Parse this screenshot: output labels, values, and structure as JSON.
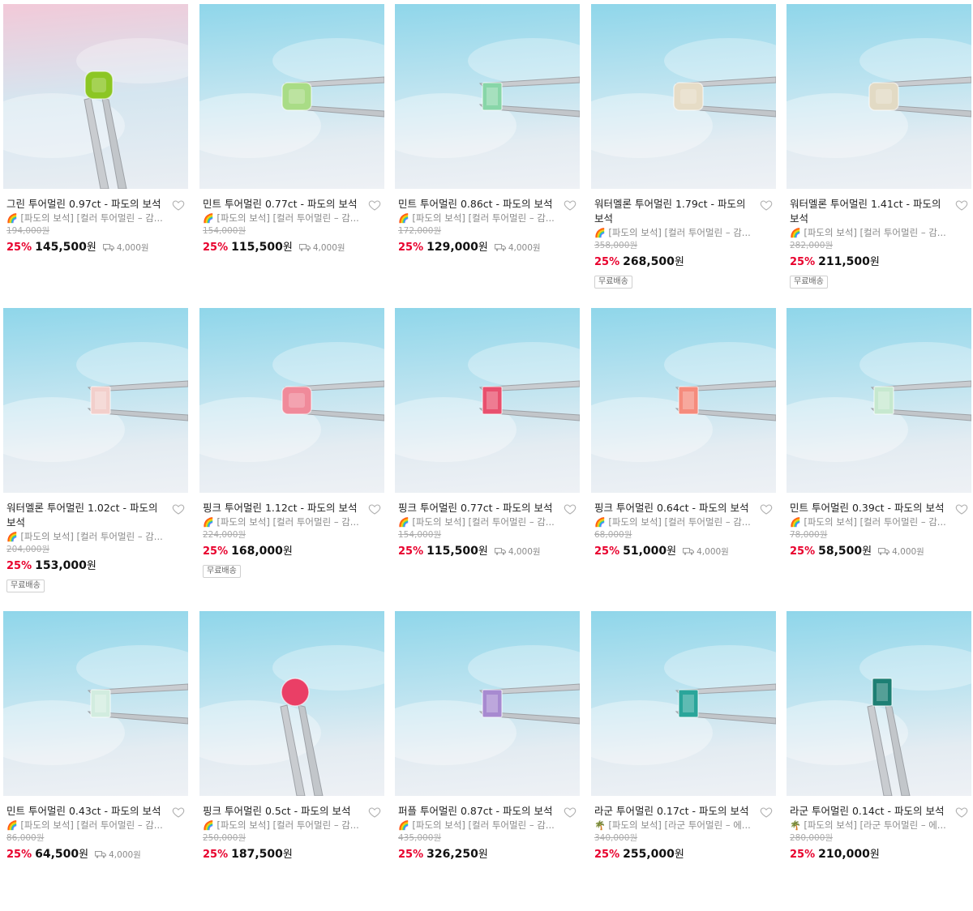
{
  "colors": {
    "discount": "#e8002d",
    "price": "#111111",
    "muted": "#8a8a8a"
  },
  "products": [
    {
      "title": "그린 투어멀린 0.97ct - 파도의 보석",
      "shop_icon": "🌈",
      "shop": "[파도의 보석] [컬러 투어멀린 – 감...",
      "original_price": "194,000원",
      "discount": "25%",
      "price": "145,500",
      "currency": "원",
      "shipping": "4,000원",
      "badge": "",
      "gem_color": "#8cc624",
      "gem_shape": "cushion",
      "bg": "pink",
      "tweezer": "diag"
    },
    {
      "title": "민트 투어멀린 0.77ct - 파도의 보석",
      "shop_icon": "🌈",
      "shop": "[파도의 보석] [컬러 투어멀린 – 감...",
      "original_price": "154,000원",
      "discount": "25%",
      "price": "115,500",
      "currency": "원",
      "shipping": "4,000원",
      "badge": "",
      "gem_color": "#a9dc86",
      "gem_shape": "square",
      "bg": "sky",
      "tweezer": "horiz"
    },
    {
      "title": "민트 투어멀린 0.86ct - 파도의 보석",
      "shop_icon": "🌈",
      "shop": "[파도의 보석] [컬러 투어멀린 – 감...",
      "original_price": "172,000원",
      "discount": "25%",
      "price": "129,000",
      "currency": "원",
      "shipping": "4,000원",
      "badge": "",
      "gem_color": "#88d6a8",
      "gem_shape": "emerald",
      "bg": "sky",
      "tweezer": "horiz"
    },
    {
      "title": "워터멜론 투어멀린 1.79ct - 파도의 보석",
      "shop_icon": "🌈",
      "shop": "[파도의 보석] [컬러 투어멀린 – 감...",
      "original_price": "358,000원",
      "discount": "25%",
      "price": "268,500",
      "currency": "원",
      "shipping": "",
      "badge": "무료배송",
      "gem_color": "#e6dcc6",
      "gem_shape": "square",
      "bg": "sky",
      "tweezer": "horiz"
    },
    {
      "title": "워터멜론 투어멀린 1.41ct - 파도의 보석",
      "shop_icon": "🌈",
      "shop": "[파도의 보석] [컬러 투어멀린 – 감...",
      "original_price": "282,000원",
      "discount": "25%",
      "price": "211,500",
      "currency": "원",
      "shipping": "",
      "badge": "무료배송",
      "gem_color": "#e2dac4",
      "gem_shape": "square",
      "bg": "sky",
      "tweezer": "horiz"
    },
    {
      "title": "워터멜론 투어멀린 1.02ct - 파도의 보석",
      "shop_icon": "🌈",
      "shop": "[파도의 보석] [컬러 투어멀린 – 감...",
      "original_price": "204,000원",
      "discount": "25%",
      "price": "153,000",
      "currency": "원",
      "shipping": "",
      "badge": "무료배송",
      "gem_color": "#f2cfcb",
      "gem_shape": "emerald",
      "bg": "sky",
      "tweezer": "horiz"
    },
    {
      "title": "핑크 투어멀린 1.12ct - 파도의 보석",
      "shop_icon": "🌈",
      "shop": "[파도의 보석] [컬러 투어멀린 – 감...",
      "original_price": "224,000원",
      "discount": "25%",
      "price": "168,000",
      "currency": "원",
      "shipping": "",
      "badge": "무료배송",
      "gem_color": "#f08a9a",
      "gem_shape": "square",
      "bg": "sky",
      "tweezer": "horiz"
    },
    {
      "title": "핑크 투어멀린 0.77ct - 파도의 보석",
      "shop_icon": "🌈",
      "shop": "[파도의 보석] [컬러 투어멀린 – 감...",
      "original_price": "154,000원",
      "discount": "25%",
      "price": "115,500",
      "currency": "원",
      "shipping": "4,000원",
      "badge": "",
      "gem_color": "#e8506e",
      "gem_shape": "emerald",
      "bg": "sky",
      "tweezer": "horiz"
    },
    {
      "title": "핑크 투어멀린 0.64ct - 파도의 보석",
      "shop_icon": "🌈",
      "shop": "[파도의 보석] [컬러 투어멀린 – 감...",
      "original_price": "68,000원",
      "discount": "25%",
      "price": "51,000",
      "currency": "원",
      "shipping": "4,000원",
      "badge": "",
      "gem_color": "#f58b7c",
      "gem_shape": "emerald",
      "bg": "sky",
      "tweezer": "horiz"
    },
    {
      "title": "민트 투어멀린 0.39ct - 파도의 보석",
      "shop_icon": "🌈",
      "shop": "[파도의 보석] [컬러 투어멀린 – 감...",
      "original_price": "78,000원",
      "discount": "25%",
      "price": "58,500",
      "currency": "원",
      "shipping": "4,000원",
      "badge": "",
      "gem_color": "#c6e8cf",
      "gem_shape": "emerald",
      "bg": "sky",
      "tweezer": "horiz"
    },
    {
      "title": "민트 투어멀린 0.43ct - 파도의 보석",
      "shop_icon": "🌈",
      "shop": "[파도의 보석] [컬러 투어멀린 – 감...",
      "original_price": "86,000원",
      "discount": "25%",
      "price": "64,500",
      "currency": "원",
      "shipping": "4,000원",
      "badge": "",
      "gem_color": "#d2ecdf",
      "gem_shape": "emerald",
      "bg": "sky",
      "tweezer": "horiz"
    },
    {
      "title": "핑크 투어멀린 0.5ct - 파도의 보석",
      "shop_icon": "🌈",
      "shop": "[파도의 보석] [컬러 투어멀린 – 감...",
      "original_price": "250,000원",
      "discount": "25%",
      "price": "187,500",
      "currency": "원",
      "shipping": "",
      "badge": "",
      "gem_color": "#ea3f66",
      "gem_shape": "round",
      "bg": "sky",
      "tweezer": "diag"
    },
    {
      "title": "퍼플 투어멀린 0.87ct - 파도의 보석",
      "shop_icon": "🌈",
      "shop": "[파도의 보석] [컬러 투어멀린 – 감...",
      "original_price": "435,000원",
      "discount": "25%",
      "price": "326,250",
      "currency": "원",
      "shipping": "",
      "badge": "",
      "gem_color": "#a78ad0",
      "gem_shape": "emerald",
      "bg": "sky",
      "tweezer": "horiz"
    },
    {
      "title": "라군 투어멀린 0.17ct - 파도의 보석",
      "shop_icon": "🌴",
      "shop": "[파도의 보석] [라군 투어멀린 – 에...",
      "original_price": "340,000원",
      "discount": "25%",
      "price": "255,000",
      "currency": "원",
      "shipping": "",
      "badge": "",
      "gem_color": "#2aa59a",
      "gem_shape": "emerald",
      "bg": "sky",
      "tweezer": "horiz"
    },
    {
      "title": "라군 투어멀린 0.14ct - 파도의 보석",
      "shop_icon": "🌴",
      "shop": "[파도의 보석] [라군 투어멀린 – 에...",
      "original_price": "280,000원",
      "discount": "25%",
      "price": "210,000",
      "currency": "원",
      "shipping": "",
      "badge": "",
      "gem_color": "#1d7f74",
      "gem_shape": "emerald",
      "bg": "sky",
      "tweezer": "diag"
    }
  ]
}
